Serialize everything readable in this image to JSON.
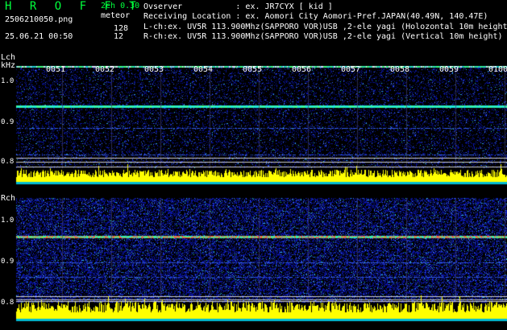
{
  "header": {
    "logo": "H R O F F T",
    "version": "2ch 0.30",
    "filename": "2506210050.png",
    "kind": "meteor",
    "timestamp": "25.06.21 00:50",
    "lch_count": "128",
    "rch_count": "12",
    "observer_line": "Ovserver           : ex. JR7CYX [ kid ]",
    "location_line": "Receiving Location : ex. Aomori City Aomori-Pref.JAPAN(40.49N, 140.47E)",
    "lch_line": "L-ch:ex. UV5R 113.900Mhz(SAPPORO VOR)USB ,2-ele yagi (Holozontal 10m height)",
    "rch_line": "R-ch:ex. UV5R 113.900Mhz(SAPPORO VOR)USB ,2-ele yagi (Vertical 10m height)"
  },
  "lch": {
    "label": "Lch",
    "unit": "kHz",
    "yticks": [
      "1.0",
      "0.9",
      "0.8"
    ],
    "minute_ticks": [
      "0051",
      "0052",
      "0053",
      "0054",
      "0055",
      "0056",
      "0057",
      "0058",
      "0059",
      "0100"
    ]
  },
  "rch": {
    "label": "Rch",
    "yticks": [
      "1.0",
      "0.9",
      "0.8"
    ]
  },
  "colors": {
    "background": "#000000",
    "logo": "#00ff3c",
    "noise_low": "#0a0a6e",
    "noise_mid": "#2a4fd0",
    "carrier": "#ff4040",
    "level_bars": "#ffff00",
    "level_base": "#00bcd4"
  }
}
